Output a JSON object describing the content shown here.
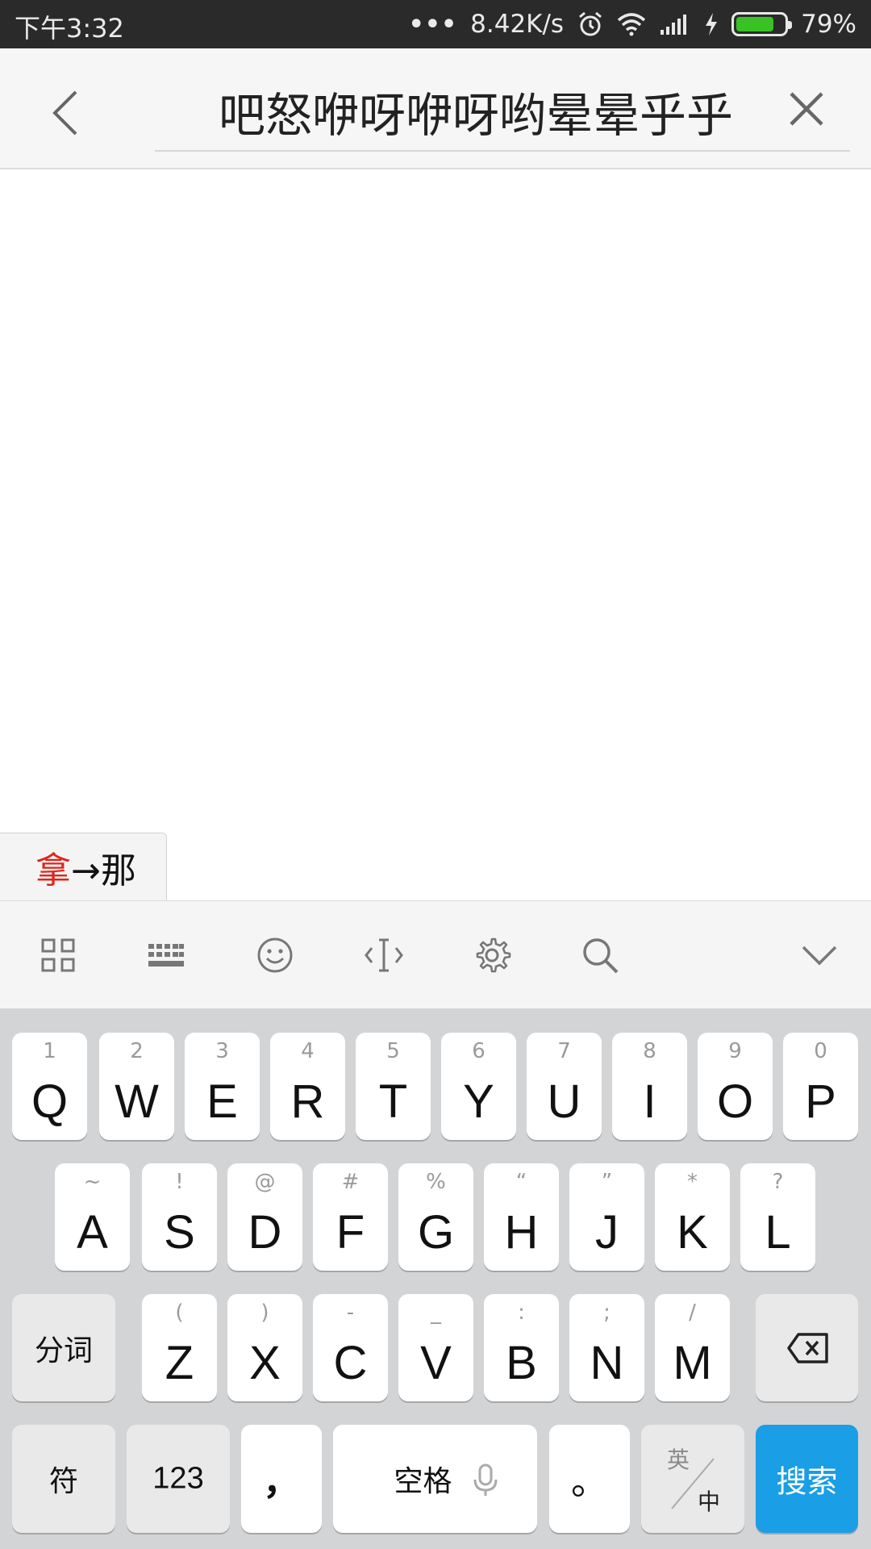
{
  "status_bar": {
    "time": "下午3:32",
    "dots": "•••",
    "net_speed": "8.42K/s",
    "battery_percent": "79%",
    "battery_level": 0.79,
    "icons": [
      "alarm-icon",
      "wifi-icon",
      "signal-icon",
      "charging-icon",
      "battery-icon"
    ]
  },
  "search": {
    "query": "吧怒咿呀咿呀哟晕晕乎乎"
  },
  "candidate": {
    "highlight": "拿",
    "rest": "→那"
  },
  "keyboard_toolbar": {
    "icons": [
      "grid-icon",
      "keyboard-icon",
      "emoji-icon",
      "cursor-icon",
      "settings-icon",
      "search-icon",
      "collapse-chevron-icon"
    ]
  },
  "keyboard": {
    "row1": [
      {
        "sub": "1",
        "main": "Q"
      },
      {
        "sub": "2",
        "main": "W"
      },
      {
        "sub": "3",
        "main": "E"
      },
      {
        "sub": "4",
        "main": "R"
      },
      {
        "sub": "5",
        "main": "T"
      },
      {
        "sub": "6",
        "main": "Y"
      },
      {
        "sub": "7",
        "main": "U"
      },
      {
        "sub": "8",
        "main": "I"
      },
      {
        "sub": "9",
        "main": "O"
      },
      {
        "sub": "0",
        "main": "P"
      }
    ],
    "row2": [
      {
        "sub": "~",
        "main": "A"
      },
      {
        "sub": "!",
        "main": "S"
      },
      {
        "sub": "@",
        "main": "D"
      },
      {
        "sub": "#",
        "main": "F"
      },
      {
        "sub": "%",
        "main": "G"
      },
      {
        "sub": "“",
        "main": "H"
      },
      {
        "sub": "”",
        "main": "J"
      },
      {
        "sub": "*",
        "main": "K"
      },
      {
        "sub": "?",
        "main": "L"
      }
    ],
    "row3": [
      {
        "sub": "(",
        "main": "Z"
      },
      {
        "sub": ")",
        "main": "X"
      },
      {
        "sub": "-",
        "main": "C"
      },
      {
        "sub": "_",
        "main": "V"
      },
      {
        "sub": ":",
        "main": "B"
      },
      {
        "sub": ";",
        "main": "N"
      },
      {
        "sub": "/",
        "main": "M"
      }
    ],
    "fenci": "分词",
    "symbols": "符",
    "numbers": "123",
    "comma": "，",
    "space": "空格",
    "period": "。",
    "lang_en": "英",
    "lang_zh": "中",
    "search_action": "搜索"
  },
  "colors": {
    "accent": "#1a9ee6",
    "candidate_highlight": "#e0241b",
    "battery": "#38c224"
  }
}
